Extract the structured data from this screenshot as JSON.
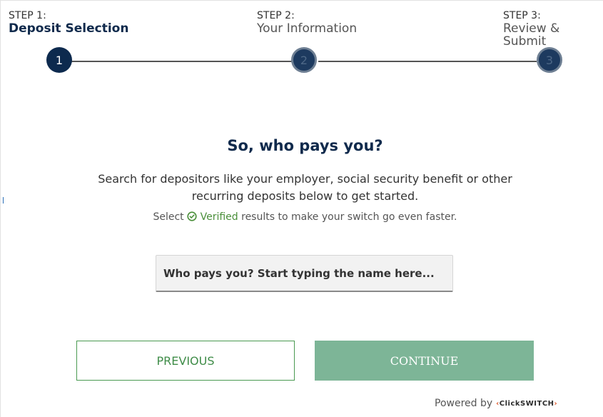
{
  "stepper": {
    "steps": [
      {
        "number_label": "STEP 1:",
        "name": "Deposit Selection",
        "dot": "1",
        "state": "active"
      },
      {
        "number_label": "STEP 2:",
        "name": "Your Information",
        "dot": "2",
        "state": "pending"
      },
      {
        "number_label": "STEP 3:",
        "name": "Review & Submit",
        "dot": "3",
        "state": "pending"
      }
    ]
  },
  "main": {
    "heading": "So, who pays you?",
    "description": "Search for depositors like your employer, social security benefit or other recurring deposits below to get started.",
    "verified_prefix": "Select",
    "verified_word": "Verified",
    "verified_suffix": "results to make your switch go even faster.",
    "search_placeholder": "Who pays you? Start typing the name here...",
    "search_value": ""
  },
  "buttons": {
    "previous": "PREVIOUS",
    "continue": "CONTINUE"
  },
  "footer": {
    "powered_by": "Powered by",
    "brand_left": "‹",
    "brand_name": "ClickSWITCH",
    "brand_right": "›"
  },
  "colors": {
    "navy": "#102a4c",
    "verified_green": "#4a8f3a",
    "previous_border": "#4a9a52",
    "continue_bg": "#7db597",
    "brand_accent": "#e0582a"
  },
  "icons": {
    "verified": "check-circle-icon"
  }
}
